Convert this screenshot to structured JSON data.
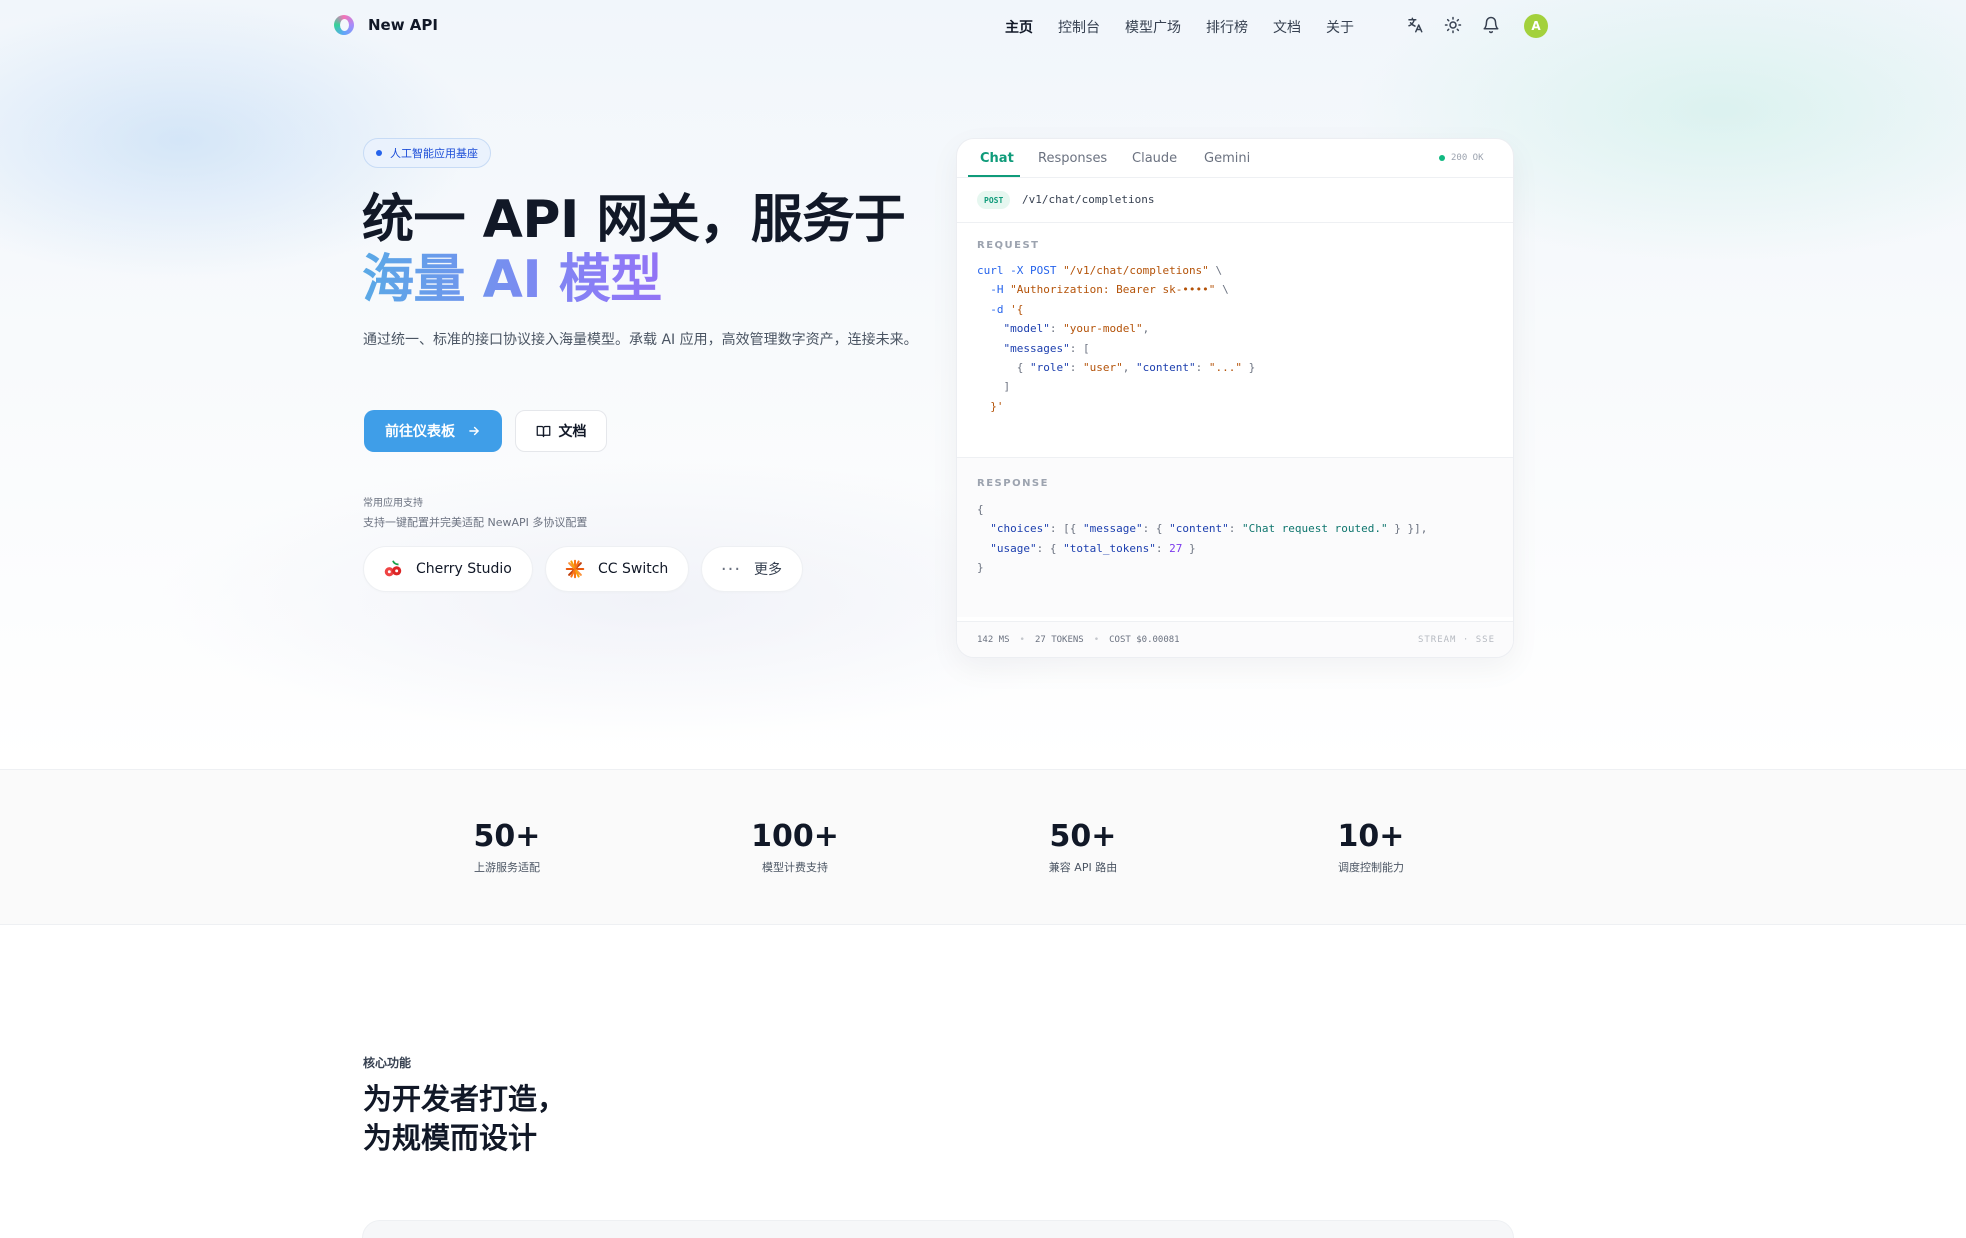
{
  "nav": {
    "brand": "New API",
    "links": [
      "主页",
      "控制台",
      "模型广场",
      "排行榜",
      "文档",
      "关于"
    ],
    "avatar_letter": "A"
  },
  "hero": {
    "badge": "人工智能应用基座",
    "title_line1": "统一 API 网关，服务于",
    "title_line2": "海量 AI 模型",
    "subtitle": "通过统一、标准的接口协议接入海量模型。承载 AI 应用，高效管理数字资产，连接未来。",
    "primary_button": "前往仪表板",
    "secondary_button": "文档",
    "support_title": "常用应用支持",
    "support_subtitle": "支持一键配置并完美适配 NewAPI 多协议配置",
    "apps": [
      "Cherry Studio",
      "CC Switch",
      "更多"
    ]
  },
  "code_card": {
    "tabs": [
      "Chat",
      "Responses",
      "Claude",
      "Gemini"
    ],
    "status": "200 OK",
    "method": "POST",
    "path": "/v1/chat/completions",
    "request_label": "REQUEST",
    "response_label": "RESPONSE",
    "footer": {
      "ms": "142 MS",
      "tokens": "27 TOKENS",
      "cost": "COST $0.00081",
      "mode": "STREAM · SSE"
    }
  },
  "stats": [
    {
      "value": "50+",
      "label": "上游服务适配"
    },
    {
      "value": "100+",
      "label": "模型计费支持"
    },
    {
      "value": "50+",
      "label": "兼容 API 路由"
    },
    {
      "value": "10+",
      "label": "调度控制能力"
    }
  ],
  "features": {
    "kicker": "核心功能",
    "title_line1": "为开发者打造，",
    "title_line2": "为规模而设计"
  },
  "colors": {
    "primary": "#3f9ee8",
    "accent_green": "#0f9b7a",
    "gradient": [
      "#5aa9e6",
      "#8b7cf6",
      "#b44cf0"
    ]
  }
}
